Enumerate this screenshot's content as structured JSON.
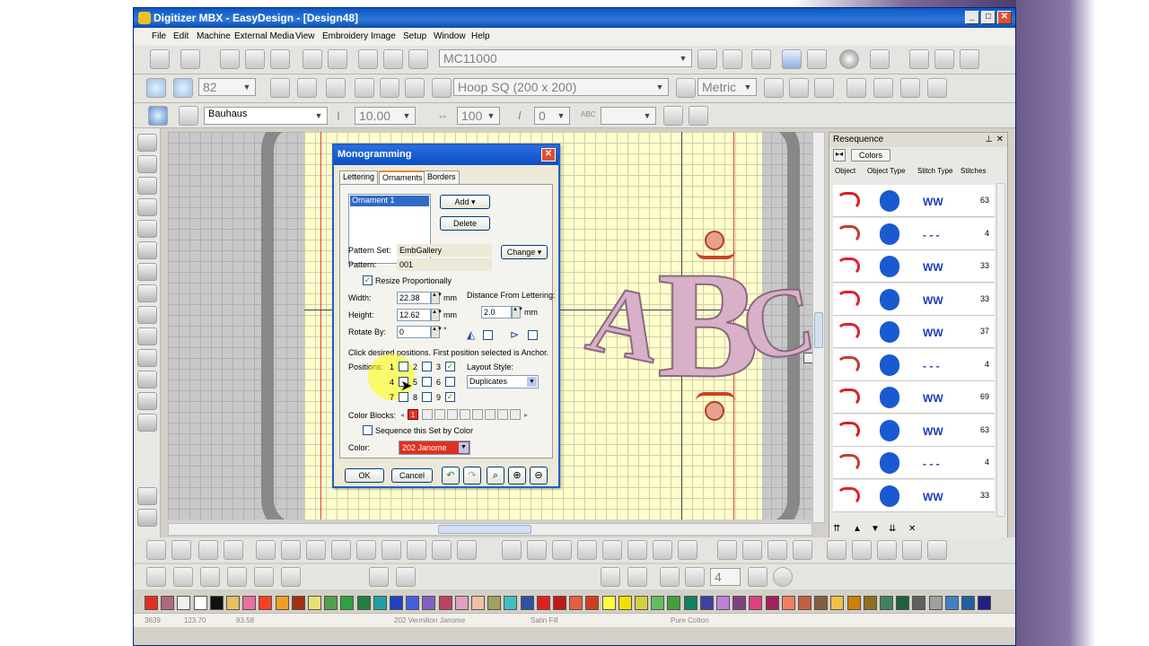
{
  "window": {
    "title": "Digitizer MBX - EasyDesign - [Design48]"
  },
  "menu": [
    "File",
    "Edit",
    "Machine",
    "External Media",
    "View",
    "Embroidery",
    "Image",
    "Setup",
    "Window",
    "Help"
  ],
  "toolbar": {
    "machine": "MC11000",
    "zoom": "82",
    "hoop": "Hoop SQ (200 x 200)",
    "units": "Metric",
    "font": "Bauhaus",
    "height": "10.00",
    "width_pct": "100",
    "slant": "0"
  },
  "canvas": {
    "letters": [
      "A",
      "B",
      "C"
    ]
  },
  "dialog": {
    "title": "Monogramming",
    "tabs": [
      "Lettering",
      "Ornaments",
      "Borders"
    ],
    "list_item": "Ornament 1",
    "add_label": "Add",
    "delete_label": "Delete",
    "pattern_set_label": "Pattern Set:",
    "pattern_set": "EmbGallery",
    "change_label": "Change",
    "pattern_label": "Pattern:",
    "pattern": "001",
    "resize_label": "Resize Proportionally",
    "width_label": "Width:",
    "width": "22.38",
    "height_label": "Height:",
    "height": "12.62",
    "rotate_label": "Rotate By:",
    "rotate": "0",
    "unit": "mm",
    "degree": "°",
    "distance_label": "Distance From Lettering:",
    "distance": "2.0",
    "hint": "Click desired positions. First position selected is Anchor.",
    "positions_label": "Positions:",
    "pos_numbers": [
      "1",
      "2",
      "3",
      "4",
      "5",
      "6",
      "7",
      "8",
      "9"
    ],
    "layout_label": "Layout Style:",
    "layout": "Duplicates",
    "color_blocks_label": "Color Blocks:",
    "color_block_first": "1",
    "sequence_label": "Sequence this Set by Color",
    "color_label": "Color:",
    "color": "202 Janome",
    "ok": "OK",
    "cancel": "Cancel"
  },
  "resequence": {
    "title": "Resequence",
    "colors_btn": "Colors",
    "headers": [
      "Object",
      "Object Type",
      "Stitch Type",
      "Stitches"
    ],
    "stitches": [
      "63",
      "4",
      "33",
      "33",
      "37",
      "4",
      "69",
      "63",
      "4",
      "33"
    ]
  },
  "status": {
    "count": "3639",
    "x": "123.70",
    "y": "93.58",
    "color": "202 Vermilion Janome",
    "fill": "Satin Fill",
    "fabric": "Pure Cotton"
  },
  "palette": [
    "#e03020",
    "#b06880",
    "#f0f0f0",
    "#ffffff",
    "#111111",
    "#e8c060",
    "#e870a0",
    "#ff4020",
    "#f0a020",
    "#a03010",
    "#e8e070",
    "#50a050",
    "#30a040",
    "#208040",
    "#20a0a0",
    "#2040c0",
    "#4060e0",
    "#8060c0",
    "#c04060",
    "#e0a0c0",
    "#f0c0a0",
    "#a0a060",
    "#40c0c0",
    "#3050a0",
    "#e02020",
    "#c01818",
    "#e06040",
    "#d04020",
    "#ffff40",
    "#f0e000",
    "#d0d040",
    "#60c060",
    "#40a040",
    "#108060",
    "#4040a0",
    "#c080e0",
    "#804080",
    "#e04080",
    "#a02060",
    "#f08060",
    "#c06040",
    "#806040",
    "#f0c040",
    "#d08000",
    "#907020",
    "#408060",
    "#206040",
    "#606060",
    "#a0a0a0",
    "#4080c0",
    "#2060a0",
    "#202080"
  ]
}
